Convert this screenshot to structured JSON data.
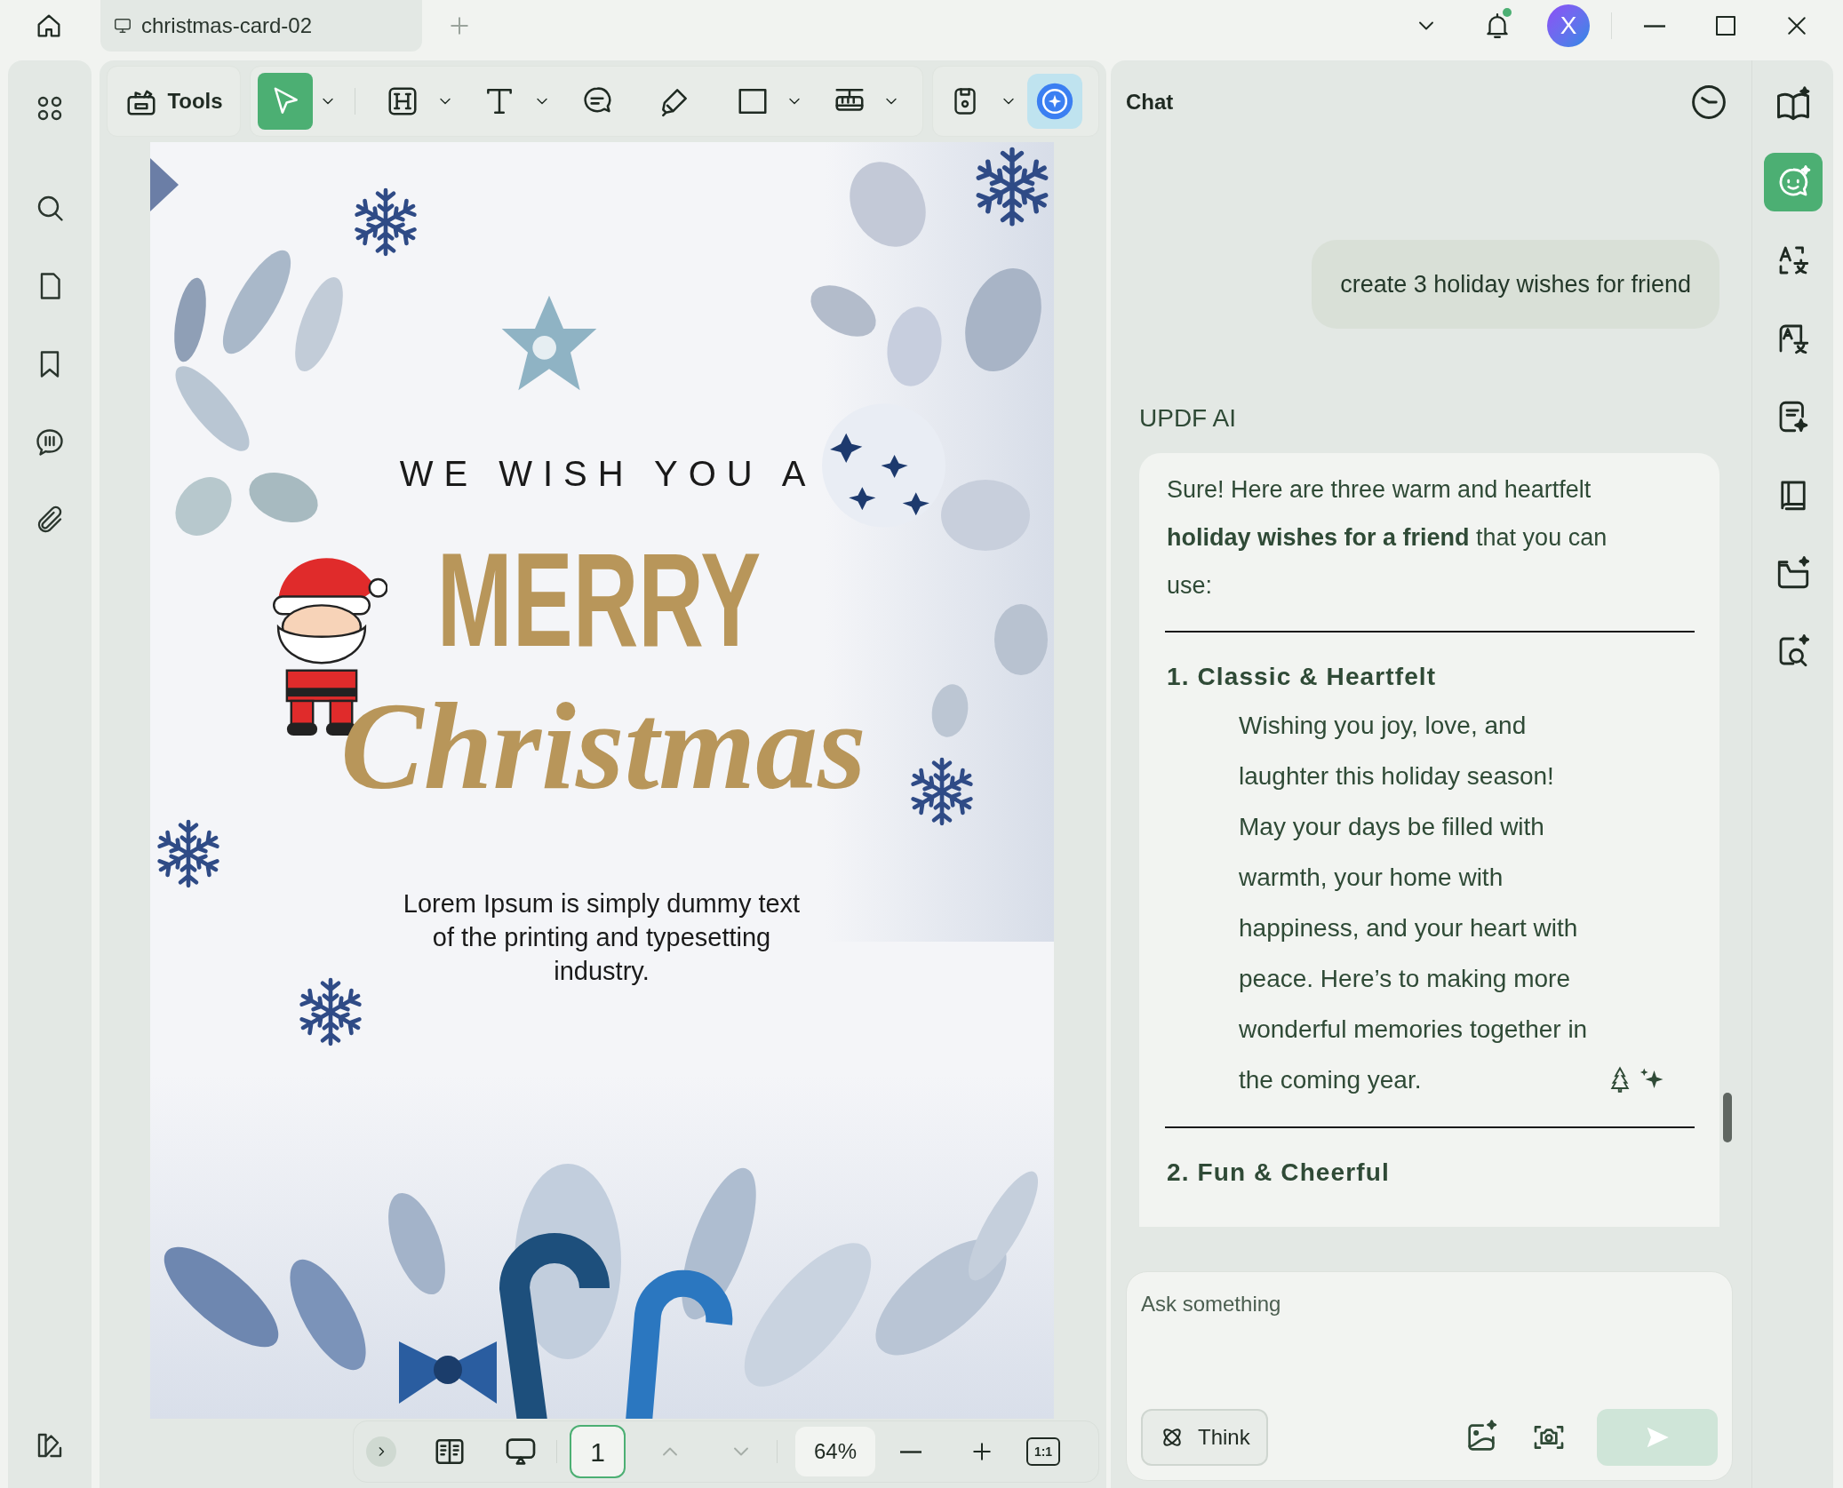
{
  "window": {
    "tab_title": "christmas-card-02",
    "avatar_letter": "X",
    "notifications_unread": true
  },
  "toolbar": {
    "tools_label": "Tools",
    "tools": [
      {
        "kind": "select",
        "selected": true,
        "menu": true
      },
      {
        "kind": "heading",
        "selected": false,
        "menu": true
      },
      {
        "kind": "text",
        "selected": false,
        "menu": true
      },
      {
        "kind": "comment",
        "selected": false,
        "menu": false
      },
      {
        "kind": "pen",
        "selected": false,
        "menu": false
      },
      {
        "kind": "shape",
        "selected": false,
        "menu": true
      },
      {
        "kind": "ruler",
        "selected": false,
        "menu": true
      }
    ]
  },
  "document": {
    "greeting": "WE WISH YOU A",
    "title_top": "MERRY",
    "title_script": "Christmas",
    "body": "Lorem Ipsum is simply dummy text of the printing and typesetting industry."
  },
  "page_nav": {
    "page": "1",
    "zoom": "64%",
    "actual_size": "1:1"
  },
  "chat": {
    "title": "Chat",
    "user_message": "create 3 holiday wishes for friend",
    "assistant_name": "UPDF AI",
    "answer": {
      "intro": "Sure! Here are three warm and heartfelt **holiday wishes for a friend** that you can use:",
      "sections": [
        {
          "heading": "1. Classic & Heartfelt",
          "body": "Wishing you joy, love, and laughter this holiday season! May your days be filled with warmth, your home with happiness, and your heart with peace. Here’s to making more wonderful memories together in the coming year."
        },
        {
          "heading": "2. Fun & Cheerful"
        }
      ]
    },
    "input": {
      "placeholder": "Ask something"
    },
    "think_label": "Think"
  },
  "right_rail": [
    {
      "kind": "chat",
      "selected": true
    },
    {
      "kind": "translate-scan",
      "selected": false
    },
    {
      "kind": "translate",
      "selected": false
    },
    {
      "kind": "summarize",
      "selected": false
    },
    {
      "kind": "book",
      "selected": false
    },
    {
      "kind": "folder",
      "selected": false
    },
    {
      "kind": "search",
      "selected": false
    }
  ]
}
